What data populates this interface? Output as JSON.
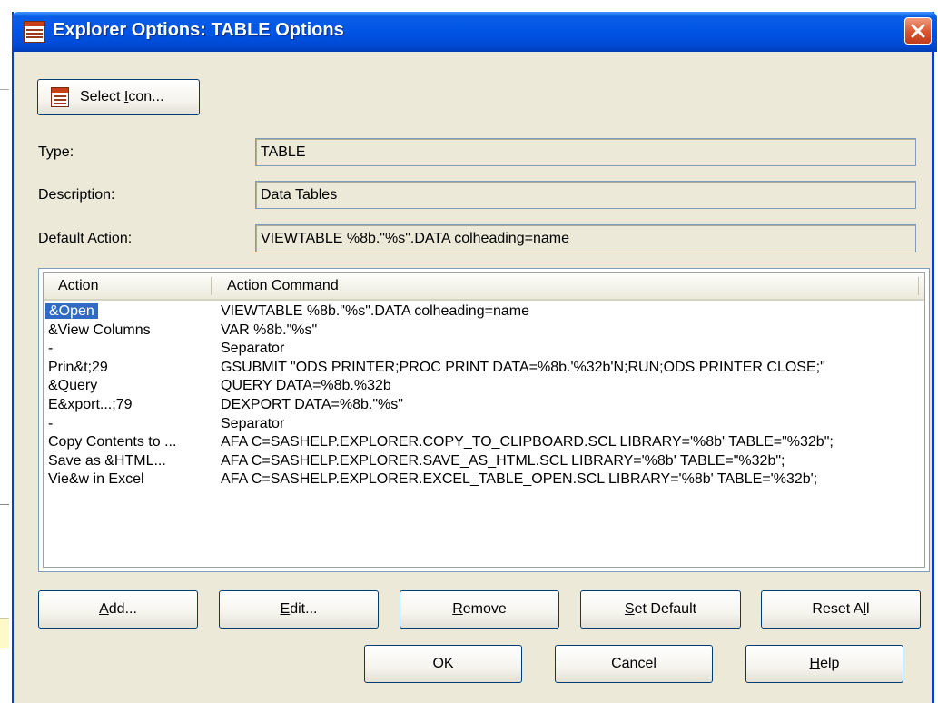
{
  "window": {
    "title": "Explorer Options: TABLE Options"
  },
  "select_icon": {
    "label_pre": "Select ",
    "label_u": "I",
    "label_post": "con..."
  },
  "fields": {
    "type": {
      "label": "Type:",
      "value": "TABLE"
    },
    "description": {
      "label": "Description:",
      "value": "Data Tables"
    },
    "default_action": {
      "label": "Default Action:",
      "value": "VIEWTABLE %8b.\"%s\".DATA colheading=name"
    }
  },
  "list": {
    "columns": [
      "Action",
      "Action Command"
    ],
    "rows": [
      {
        "action": "&Open",
        "command": "VIEWTABLE %8b.\"%s\".DATA colheading=name",
        "selected": true
      },
      {
        "action": "&View Columns",
        "command": "VAR %8b.\"%s\""
      },
      {
        "action": "-",
        "command": "Separator"
      },
      {
        "action": "Prin&t;29",
        "command": "GSUBMIT \"ODS PRINTER;PROC PRINT DATA=%8b.'%32b'N;RUN;ODS PRINTER CLOSE;\""
      },
      {
        "action": "&Query",
        "command": "QUERY DATA=%8b.%32b"
      },
      {
        "action": "E&xport...;79",
        "command": "DEXPORT DATA=%8b.\"%s\""
      },
      {
        "action": "-",
        "command": "Separator"
      },
      {
        "action": "Copy Contents to ...",
        "command": "AFA C=SASHELP.EXPLORER.COPY_TO_CLIPBOARD.SCL LIBRARY='%8b' TABLE=\"%32b\";"
      },
      {
        "action": "Save as &HTML...",
        "command": "AFA C=SASHELP.EXPLORER.SAVE_AS_HTML.SCL LIBRARY='%8b' TABLE=\"%32b\";"
      },
      {
        "action": "Vie&w in Excel",
        "command": "AFA C=SASHELP.EXPLORER.EXCEL_TABLE_OPEN.SCL LIBRARY='%8b' TABLE='%32b';"
      }
    ]
  },
  "buttons": {
    "add": {
      "u": "A",
      "rest": "dd..."
    },
    "edit": {
      "u": "E",
      "rest": "dit..."
    },
    "remove": {
      "u": "R",
      "rest": "emove"
    },
    "set_default": {
      "u": "S",
      "rest": "et Default"
    },
    "reset_all": {
      "pre": "Reset A",
      "u": "l",
      "rest": "l"
    },
    "ok": "OK",
    "cancel": "Cancel",
    "help": {
      "u": "H",
      "rest": "elp"
    }
  },
  "icons": {
    "title": "table-icon",
    "close": "close-icon",
    "select_icon": "table-icon"
  }
}
